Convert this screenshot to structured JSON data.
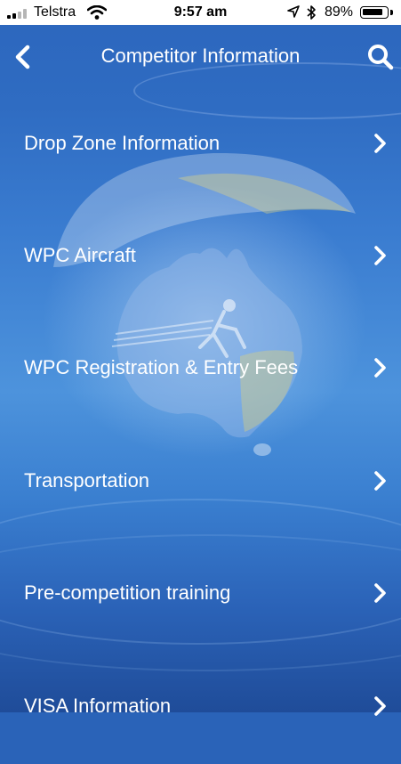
{
  "status_bar": {
    "carrier": "Telstra",
    "time": "9:57 am",
    "battery_percent": "89%",
    "battery_level": 0.89,
    "icons": [
      "signal-icon",
      "wifi-icon",
      "location-arrow-icon",
      "bluetooth-icon",
      "battery-icon"
    ]
  },
  "nav": {
    "title": "Competitor Information",
    "back_icon": "chevron-left-icon",
    "search_icon": "search-icon"
  },
  "menu": {
    "items": [
      {
        "label": "Drop Zone Information"
      },
      {
        "label": "WPC Aircraft"
      },
      {
        "label": "WPC Registration & Entry Fees"
      },
      {
        "label": "Transportation"
      },
      {
        "label": "Pre-competition training"
      },
      {
        "label": "VISA Information"
      }
    ],
    "chevron_icon": "chevron-right-icon"
  },
  "colors": {
    "background_top": "#2c66bd",
    "background_bottom": "#1f4c99",
    "text": "#ffffff",
    "status_bar_bg": "#ffffff"
  }
}
